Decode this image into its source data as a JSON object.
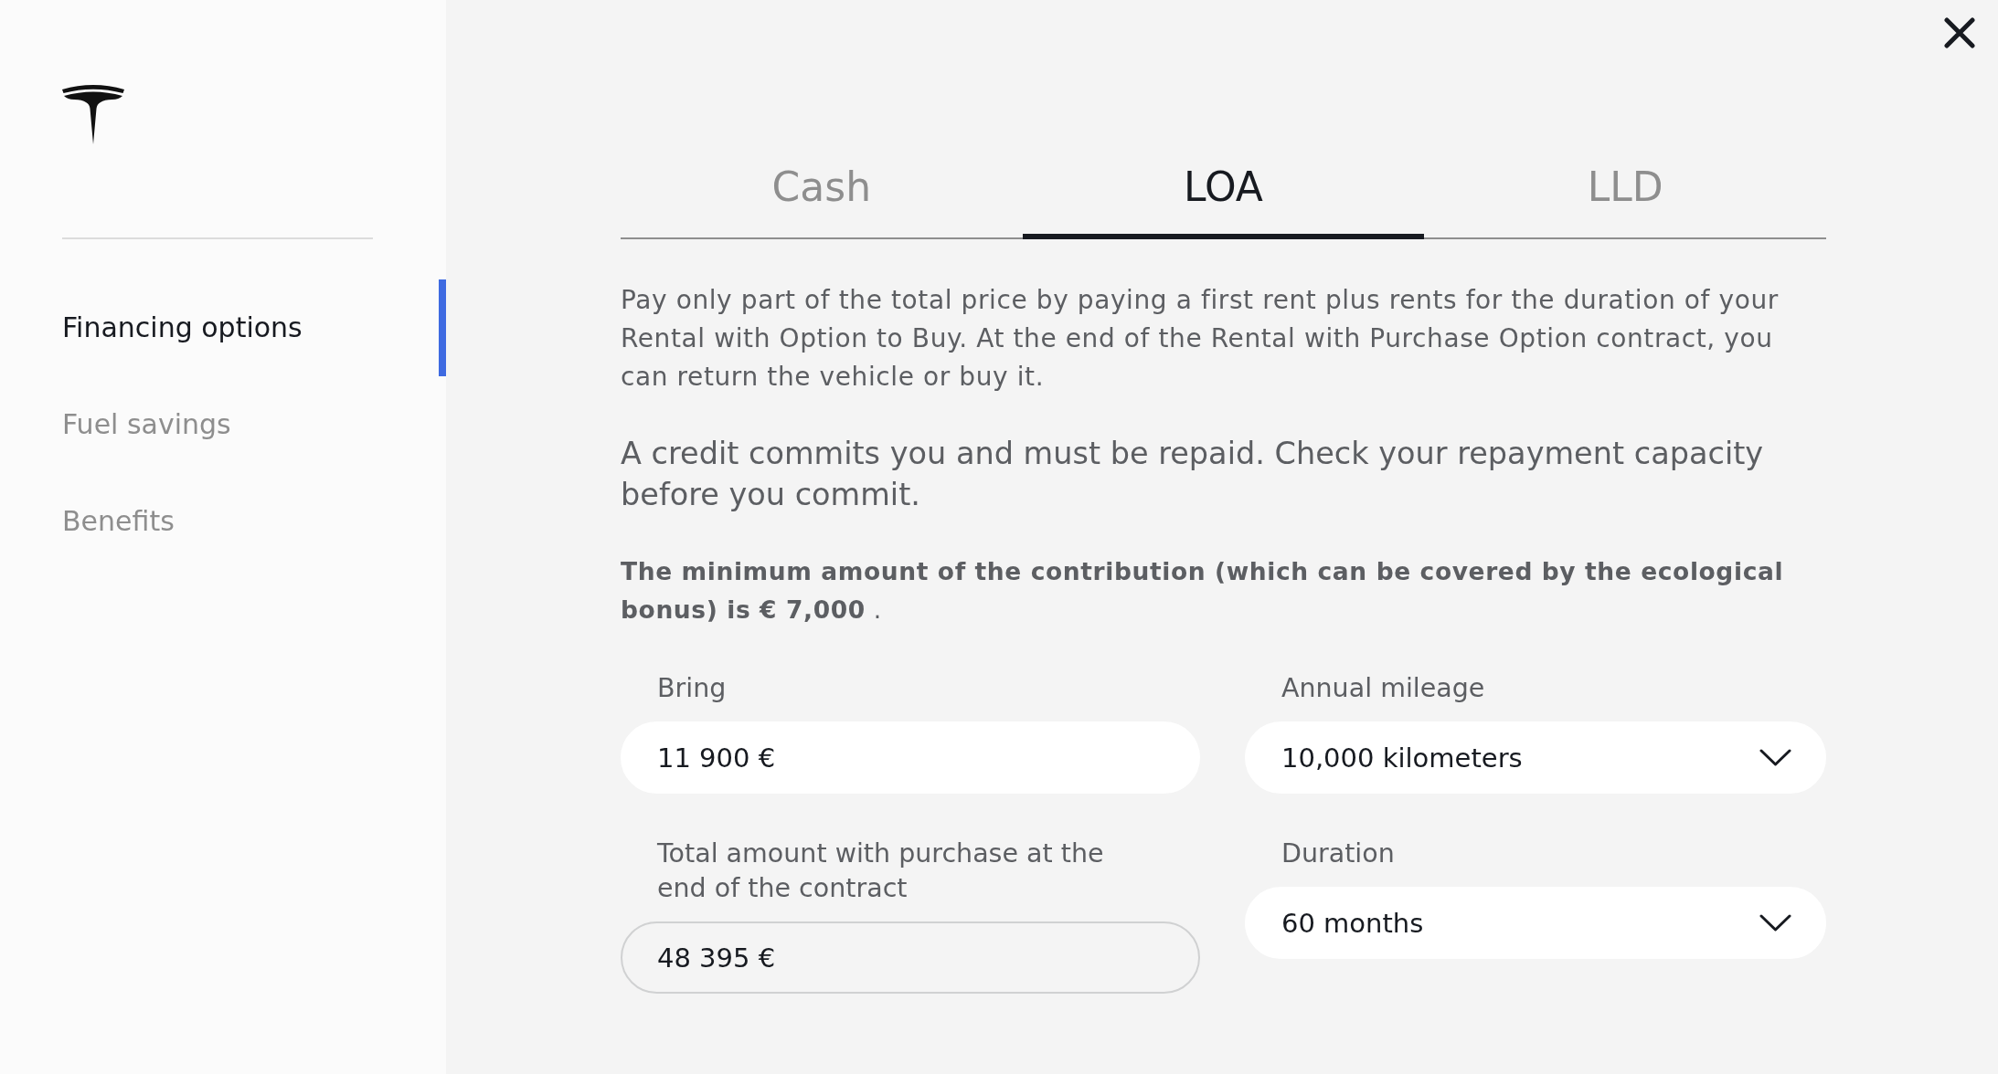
{
  "sidebar": {
    "items": [
      {
        "label": "Financing options",
        "selected": true
      },
      {
        "label": "Fuel savings",
        "selected": false
      },
      {
        "label": "Benefits",
        "selected": false
      }
    ]
  },
  "tabs": [
    {
      "label": "Cash",
      "selected": false
    },
    {
      "label": "LOA",
      "selected": true
    },
    {
      "label": "LLD",
      "selected": false
    }
  ],
  "description": "Pay only part of the total price by paying a first rent plus rents for the duration of your Rental with Option to Buy. At the end of the Rental with Purchase Option contract, you can return the vehicle or buy it.",
  "credit_warning": "A credit commits you and must be repaid. Check your repayment capacity before you commit.",
  "minimum_contribution": "**The minimum amount of the contribution (which can be covered by the ecological bonus) is € 7,000** .",
  "form": {
    "columns": [
      {
        "fields": [
          {
            "kind": "text",
            "label": "Bring",
            "value": "11 900 €"
          },
          {
            "kind": "readonly",
            "label": "Total amount with purchase at the end of the contract",
            "value": "48 395 €"
          }
        ]
      },
      {
        "fields": [
          {
            "kind": "select",
            "label": "Annual mileage",
            "value": "10,000 kilometers"
          },
          {
            "kind": "select",
            "label": "Duration",
            "value": "60 months"
          }
        ]
      }
    ]
  }
}
